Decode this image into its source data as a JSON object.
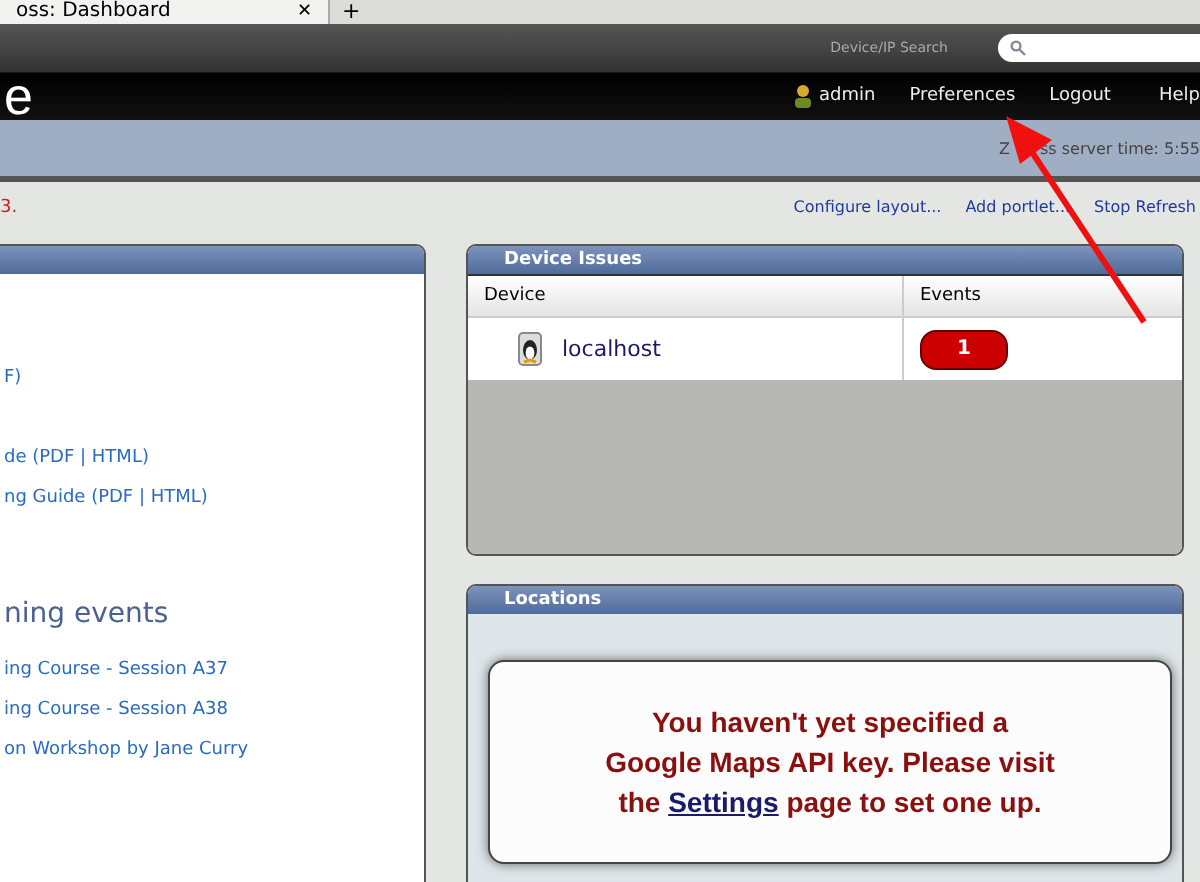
{
  "browser_tab": {
    "title": "oss: Dashboard",
    "close": "✕",
    "new_tab": "+"
  },
  "header": {
    "logo": "e",
    "search_label": "Device/IP Search",
    "user": "admin",
    "nav": [
      "Preferences",
      "Logout",
      "Help"
    ]
  },
  "info_bar": {
    "server_time_parts": [
      "Z",
      "ss server time: 5:55"
    ]
  },
  "toolbar": {
    "message": "3.",
    "links": [
      "Configure layout...",
      "Add portlet...",
      "Stop Refresh"
    ]
  },
  "left_portlet": {
    "lines": [
      {
        "text": "F)",
        "kind": "link"
      },
      {
        "text": "de (PDF | HTML)",
        "kind": "link"
      },
      {
        "text": "ng Guide (PDF | HTML)",
        "kind": "link"
      },
      {
        "text": "ning events",
        "kind": "heading"
      },
      {
        "text": "ing Course - Session A37",
        "kind": "link"
      },
      {
        "text": "ing Course - Session A38",
        "kind": "link"
      },
      {
        "text": "on Workshop by Jane Curry",
        "kind": "link"
      }
    ]
  },
  "device_issues": {
    "title": "Device Issues",
    "columns": [
      "Device",
      "Events"
    ],
    "rows": [
      {
        "device": "localhost",
        "events": "1"
      }
    ]
  },
  "locations": {
    "title": "Locations",
    "message_parts": [
      "You haven't yet specified a Google Maps API key. Please visit the ",
      "Settings",
      " page to set one up."
    ]
  }
}
